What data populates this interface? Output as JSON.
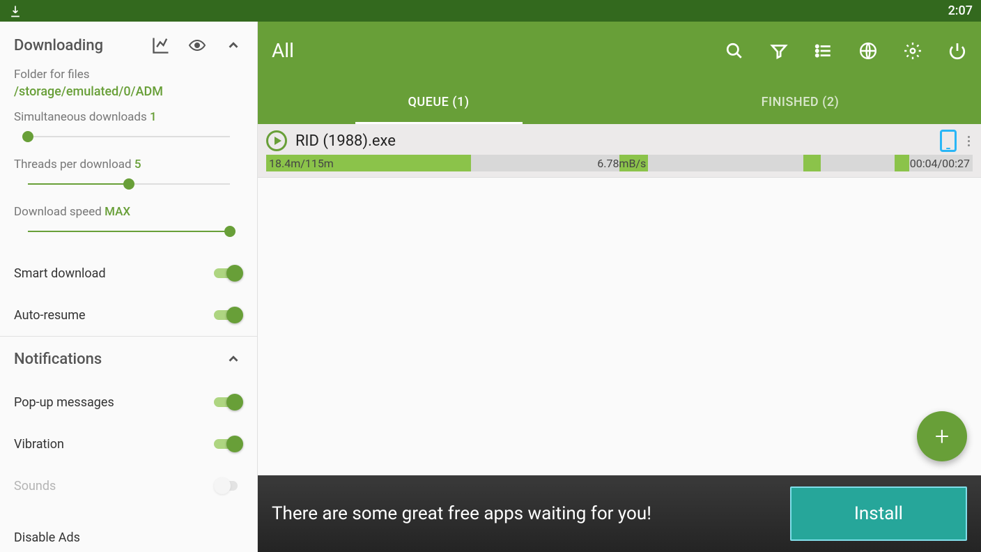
{
  "statusbar": {
    "time": "2:07"
  },
  "sidebar": {
    "downloading": {
      "title": "Downloading",
      "folder_label": "Folder for files",
      "folder_path": "/storage/emulated/0/ADM",
      "simul_label": "Simultaneous downloads ",
      "simul_value": "1",
      "threads_label": "Threads per download ",
      "threads_value": "5",
      "speed_label": "Download speed ",
      "speed_value": "MAX",
      "smart_download": "Smart download",
      "auto_resume": "Auto-resume"
    },
    "notifications": {
      "title": "Notifications",
      "popup": "Pop-up messages",
      "vibration": "Vibration",
      "sounds": "Sounds"
    },
    "disable_ads": "Disable Ads"
  },
  "main": {
    "title": "All",
    "tabs": {
      "queue": "QUEUE (1)",
      "finished": "FINISHED (2)"
    },
    "download": {
      "name": "RID (1988).exe",
      "progress_text": "18.4m/115m",
      "speed_text": "6.78mB/s",
      "time_text": "00:04/00:27"
    },
    "ad": {
      "text": "There are some great free apps waiting for you!",
      "button": "Install"
    }
  }
}
